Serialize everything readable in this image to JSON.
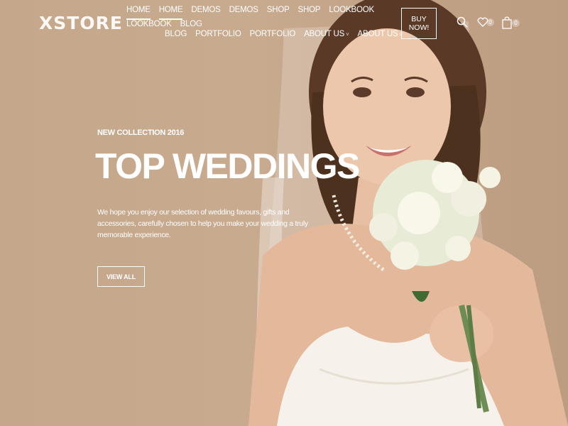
{
  "brand": {
    "logo_text": "XSTORE"
  },
  "nav": {
    "row1": [
      {
        "label": "HOME",
        "active": true
      },
      {
        "label": "HOME",
        "active": true
      },
      {
        "label": "DEMOS",
        "active": false
      },
      {
        "label": "DEMOS",
        "active": false
      },
      {
        "label": "SHOP",
        "active": false
      },
      {
        "label": "SHOP",
        "active": false
      },
      {
        "label": "LOOKBOOK",
        "active": false
      },
      {
        "label": "LOOKBOOK",
        "active": false
      },
      {
        "label": "BLOG",
        "active": false
      }
    ],
    "row2": [
      {
        "label": "BLOG",
        "has_caret": false
      },
      {
        "label": "PORTFOLIO",
        "has_caret": false
      },
      {
        "label": "PORTFOLIO",
        "has_caret": false
      },
      {
        "label": "ABOUT US",
        "has_caret": true
      },
      {
        "label": "ABOUT US",
        "has_caret": true
      }
    ]
  },
  "header_actions": {
    "buy_label": "BUY NOW!",
    "search_icon": "search-icon",
    "wishlist_icon": "heart-icon",
    "wishlist_count": "0",
    "cart_icon": "shopping-bag-icon",
    "cart_count": "0"
  },
  "hero": {
    "eyebrow": "NEW COLLECTION 2016",
    "title": "TOP WEDDINGS",
    "description": "We hope you enjoy our selection of wedding favours, gifts and accessories, carefully chosen to help you make your wedding a truly memorable experience.",
    "cta_label": "VIEW ALL",
    "image_subject": "bride-with-bouquet"
  },
  "colors": {
    "background": "#c8ab90",
    "text": "#ffffff"
  }
}
